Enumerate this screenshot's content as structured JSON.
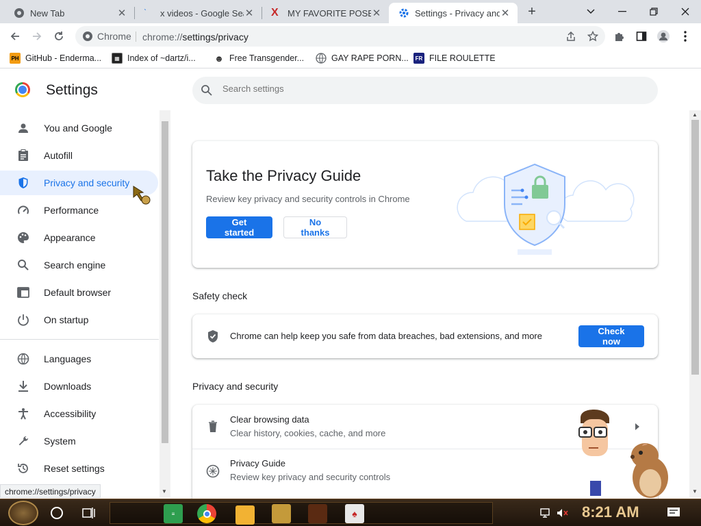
{
  "tabs": [
    {
      "title": "New Tab"
    },
    {
      "title": "x videos - Google Sea"
    },
    {
      "title": "MY FAVORITE POSE"
    },
    {
      "title": "Settings - Privacy and"
    }
  ],
  "omnibox": {
    "site_label": "Chrome",
    "host": "chrome://",
    "path": "settings/privacy"
  },
  "bookmarks": [
    {
      "label": "GitHub - Enderma...",
      "fav_text": "PH"
    },
    {
      "label": "Index of ~dartz/i..."
    },
    {
      "label": "Free Transgender..."
    },
    {
      "label": "GAY RAPE PORN..."
    },
    {
      "label": "FILE ROULETTE",
      "fav_text": "FR"
    }
  ],
  "settings": {
    "title": "Settings",
    "search_placeholder": "Search settings"
  },
  "sidebar": {
    "items": [
      {
        "label": "You and Google",
        "icon": "person-icon"
      },
      {
        "label": "Autofill",
        "icon": "clipboard-icon"
      },
      {
        "label": "Privacy and security",
        "icon": "shield-icon",
        "selected": true
      },
      {
        "label": "Performance",
        "icon": "gauge-icon"
      },
      {
        "label": "Appearance",
        "icon": "palette-icon"
      },
      {
        "label": "Search engine",
        "icon": "search-icon"
      },
      {
        "label": "Default browser",
        "icon": "browser-icon"
      },
      {
        "label": "On startup",
        "icon": "power-icon"
      },
      {
        "label": "Languages",
        "icon": "globe-icon"
      },
      {
        "label": "Downloads",
        "icon": "download-icon"
      },
      {
        "label": "Accessibility",
        "icon": "accessibility-icon"
      },
      {
        "label": "System",
        "icon": "wrench-icon"
      },
      {
        "label": "Reset settings",
        "icon": "reset-icon"
      }
    ]
  },
  "privacy_guide": {
    "title": "Take the Privacy Guide",
    "subtitle": "Review key privacy and security controls in Chrome",
    "primary_button": "Get started",
    "secondary_button": "No thanks"
  },
  "safety_check": {
    "heading": "Safety check",
    "text": "Chrome can help keep you safe from data breaches, bad extensions, and more",
    "button": "Check now"
  },
  "privacy_section": {
    "heading": "Privacy and security",
    "rows": [
      {
        "title": "Clear browsing data",
        "subtitle": "Clear history, cookies, cache, and more"
      },
      {
        "title": "Privacy Guide",
        "subtitle": "Review key privacy and security controls"
      }
    ]
  },
  "status_bar_url": "chrome://settings/privacy",
  "taskbar": {
    "clock": "8:21 AM"
  },
  "colors": {
    "accent": "#1a73e8",
    "selected_bg": "#e8f0fe",
    "tabstrip": "#dee1e6"
  }
}
